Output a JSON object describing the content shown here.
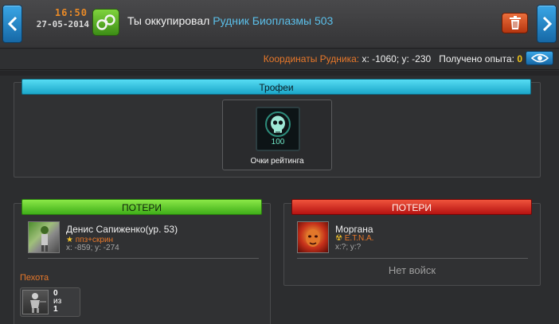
{
  "header": {
    "time": "16:50",
    "date": "27-05-2014",
    "title_prefix": "Ты оккупировал",
    "mine_name": "Рудник Биоплазмы 503"
  },
  "info": {
    "coords_label": "Координаты Рудника:",
    "coords_value": "x: -1060; y: -230",
    "exp_label": "Получено опыта:",
    "exp_value": "0"
  },
  "trophies": {
    "title": "Трофеи",
    "item": {
      "value": "100",
      "label": "Очки рейтинга"
    }
  },
  "losses_left": {
    "title": "ПОТЕРИ",
    "player": {
      "name": "Денис Сапиженко(ур. 53)",
      "alliance": "ппз+скрин",
      "coords": "x: -859; y: -274"
    },
    "section": "Пехота",
    "unit": {
      "count": "0",
      "of": "из",
      "total": "1"
    }
  },
  "losses_right": {
    "title": "ПОТЕРИ",
    "player": {
      "name": "Моргана",
      "alliance": "E.T.N.A.",
      "coords": "x:?; y:?"
    },
    "empty_text": "Нет войск"
  },
  "colors": {
    "accent_orange": "#e8782a",
    "accent_blue": "#5bbfe9",
    "header_cyan": "#1ba6c9",
    "header_green": "#3fae19",
    "header_red": "#b51211"
  },
  "icons": [
    "chevron-left-icon",
    "chevron-right-icon",
    "handcuffs-icon",
    "trash-icon",
    "eye-icon",
    "skull-icon",
    "star-icon",
    "radiation-icon"
  ]
}
